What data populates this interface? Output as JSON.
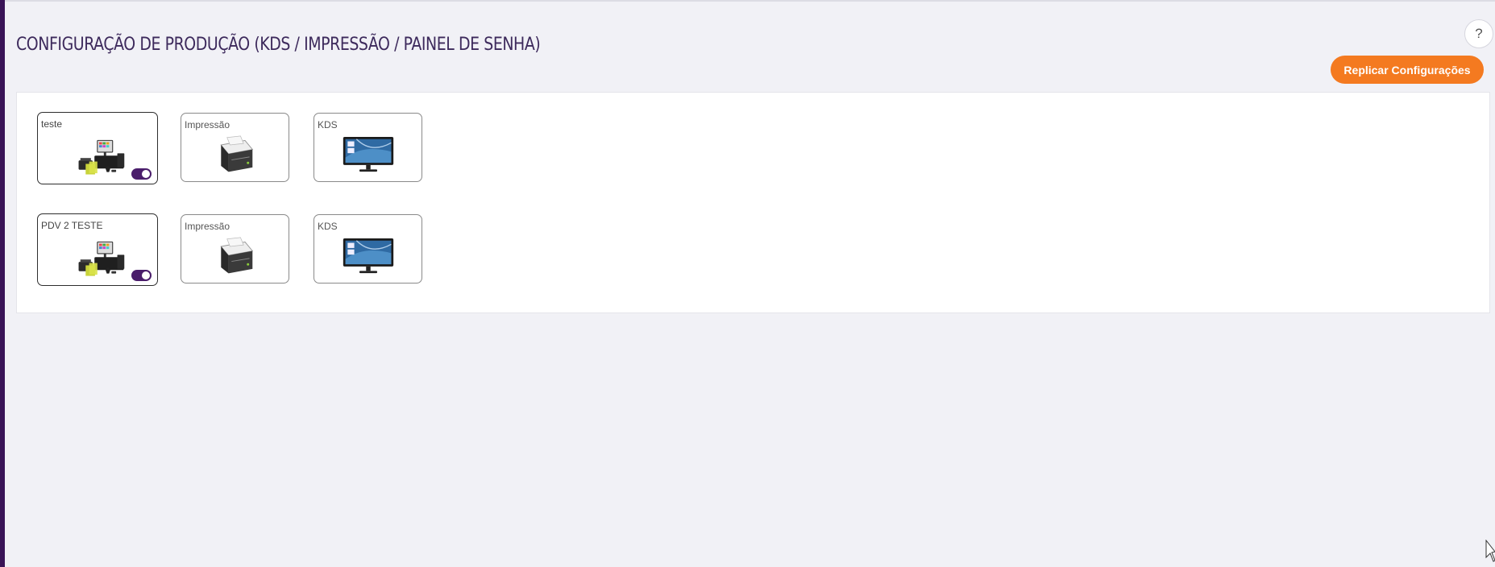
{
  "page": {
    "title": "CONFIGURAÇÃO DE PRODUÇÃO (KDS / IMPRESSÃO / PAINEL DE SENHA)",
    "help_label": "?",
    "replicate_label": "Replicar Configurações"
  },
  "colors": {
    "accent_orange": "#f47a20",
    "sidebar_purple": "#3a1457",
    "title_purple": "#3d2a5c",
    "toggle_purple": "#4a1d6b"
  },
  "rows": [
    {
      "pdv": {
        "label": "teste",
        "icon": "pos-terminal-icon",
        "enabled": true
      },
      "printer": {
        "label": "Impressão",
        "icon": "thermal-printer-icon"
      },
      "kds": {
        "label": "KDS",
        "icon": "monitor-icon"
      }
    },
    {
      "pdv": {
        "label": "PDV 2 TESTE",
        "icon": "pos-terminal-icon",
        "enabled": true
      },
      "printer": {
        "label": "Impressão",
        "icon": "thermal-printer-icon"
      },
      "kds": {
        "label": "KDS",
        "icon": "monitor-icon"
      }
    }
  ]
}
